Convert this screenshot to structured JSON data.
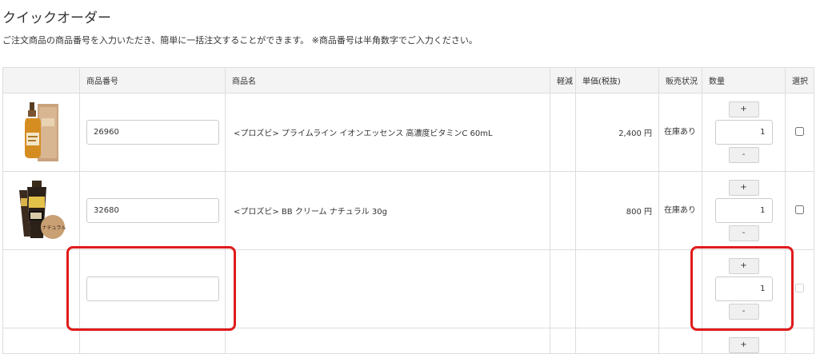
{
  "page": {
    "title": "クイックオーダー",
    "intro": "ご注文商品の商品番号を入力いただき、簡単に一括注文することができます。 ※商品番号は半角数字でご入力ください。"
  },
  "table": {
    "headers": {
      "code": "商品番号",
      "name": "商品名",
      "reduced": "軽減",
      "price": "単価(税抜)",
      "status": "販売状況",
      "qty": "数量",
      "select": "選択"
    },
    "plus_label": "+",
    "minus_label": "-",
    "rows": [
      {
        "code": "26960",
        "name": "<プロズビ> プライムライン イオンエッセンス 高濃度ビタミンC 60mL",
        "reduced": "",
        "price": "2,400 円",
        "status": "在庫あり",
        "qty": "1",
        "thumb_icon": "serum-bottle-icon"
      },
      {
        "code": "32680",
        "name": "<プロズビ> BB クリーム ナチュラル 30g",
        "reduced": "",
        "price": "800 円",
        "status": "在庫あり",
        "qty": "1",
        "thumb_icon": "bb-cream-tube-icon",
        "thumb_text": "ナチュラル"
      },
      {
        "code": "",
        "name": "",
        "reduced": "",
        "price": "",
        "status": "",
        "qty": "1"
      }
    ]
  },
  "colors": {
    "highlight": "#e01b1b",
    "header_bg": "#f4f4f4",
    "border": "#dddddd"
  }
}
